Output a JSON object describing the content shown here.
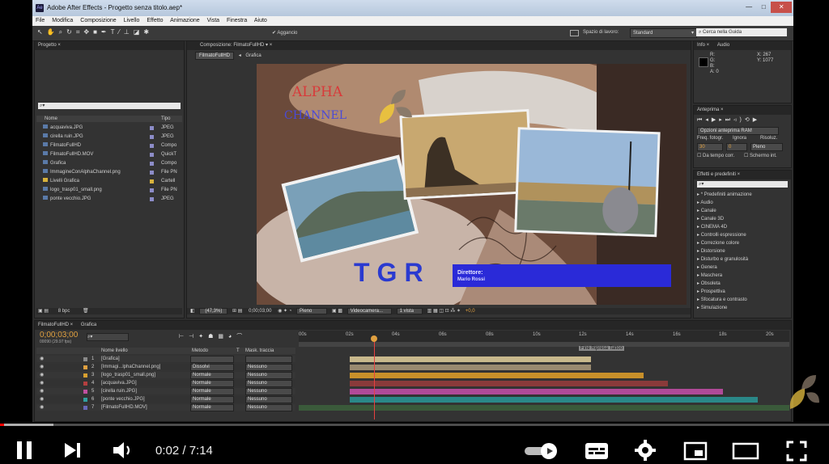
{
  "app": {
    "title": "Adobe After Effects - Progetto senza titolo.aep*",
    "logo_text": "Ae",
    "window_buttons": [
      "—",
      "□",
      "✕"
    ]
  },
  "menu": [
    "File",
    "Modifica",
    "Composizione",
    "Livello",
    "Effetto",
    "Animazione",
    "Vista",
    "Finestra",
    "Aiuto"
  ],
  "toolbar": {
    "snap_label": "Aggancio",
    "workspace_label": "Spazio di lavoro:",
    "workspace_value": "Standard",
    "help_placeholder": "Cerca nella Guida"
  },
  "project_panel": {
    "tab": "Progetto",
    "col_name": "Nome",
    "col_type": "Tipo",
    "items": [
      {
        "name": "acquaviva.JPG",
        "type": "JPEG",
        "color": "#8c8cc8"
      },
      {
        "name": "cirella ruin.JPG",
        "type": "JPEG",
        "color": "#8c8cc8"
      },
      {
        "name": "FilmatoFullHD",
        "type": "Compo",
        "color": "#8c8cc8"
      },
      {
        "name": "FilmatoFullHD.MOV",
        "type": "QuickT",
        "color": "#8c8cc8"
      },
      {
        "name": "Grafica",
        "type": "Compo",
        "color": "#8c8cc8"
      },
      {
        "name": "ImmagineConAlphaChannel.png",
        "type": "File PN",
        "color": "#8c8cc8"
      },
      {
        "name": "Livelli Grafica",
        "type": "Cartell",
        "color": "#d8b23c"
      },
      {
        "name": "logo_trasp01_small.png",
        "type": "File PN",
        "color": "#8c8cc8"
      },
      {
        "name": "ponte vecchio.JPG",
        "type": "JPEG",
        "color": "#8c8cc8"
      }
    ],
    "bpc": "8 bpc"
  },
  "comp_panel": {
    "tab": "Composizione: FilmatoFullHD",
    "subtabs": [
      "FilmatoFullHD",
      "Grafica"
    ],
    "zoom": "(47,3%)",
    "timecode": "0;00;03;00",
    "resolution": "Pieno",
    "camera": "Videocamera...",
    "view": "1 vista",
    "offset": "+0,0"
  },
  "overlay": {
    "alpha_line1": "ALPHA",
    "alpha_line2": "CHANNEL",
    "tgr": "TGR",
    "lower_third_title": "Direttore:",
    "lower_third_name": "Mario Rossi"
  },
  "info_panel": {
    "tabs": [
      "Info",
      "Audio"
    ],
    "channels": [
      "R:",
      "G:",
      "B:",
      "A: 0"
    ],
    "x": "X: 267",
    "y": "Y: 1077"
  },
  "preview_panel": {
    "tab": "Anteprima",
    "ram_options": "Opzioni anteprima RAM",
    "frame_rate_label": "Freq. fotogr.",
    "skip_label": "Ignora",
    "resolution_label": "Risoluz.",
    "frame_rate": "30",
    "skip": "0",
    "resolution": "Pieno",
    "current_time": "Da tempo corr.",
    "fullscreen": "Schermo int."
  },
  "effects_panel": {
    "tab": "Effetti e predefiniti",
    "items": [
      "* Predefiniti animazione",
      "Audio",
      "Canale",
      "Canale 3D",
      "CINEMA 4D",
      "Controlli espressione",
      "Correzione colore",
      "Distorsione",
      "Disturbo e granulosità",
      "Genera",
      "Maschera",
      "Obsoleta",
      "Prospettiva",
      "Sfocatura e contrasto",
      "Simulazione"
    ]
  },
  "timeline": {
    "tabs": [
      "FilmatoFullHD",
      "Grafica"
    ],
    "timecode": "0;00;03;00",
    "timecode_sub": "00090 (29.97 fps)",
    "col_name": "Nome livello",
    "col_mode": "Metodo",
    "col_track": "T",
    "col_matte": "Mask. traccia",
    "ruler": [
      "00s",
      "02s",
      "04s",
      "06s",
      "08s",
      "10s",
      "12s",
      "14s",
      "16s",
      "18s",
      "20s"
    ],
    "marker_label": "Fine Ripresa Tattoo",
    "layers": [
      {
        "num": "1",
        "name": "[Grafica]",
        "mode": "",
        "matte": "",
        "color": "#8a8a8a",
        "bar_color": "#c8b88c",
        "bar_start": 0.104,
        "bar_end": 0.596
      },
      {
        "num": "2",
        "name": "[Immagi...lphaChannel.png]",
        "mode": "Dissolvi",
        "matte": "Nessuno",
        "color": "#e0a040",
        "bar_color": "#9a8a70",
        "bar_start": 0.104,
        "bar_end": 0.596
      },
      {
        "num": "3",
        "name": "[logo_trasp01_small.png]",
        "mode": "Normale",
        "matte": "Nessuno",
        "color": "#d8a030",
        "bar_color": "#c8902a",
        "bar_start": 0.104,
        "bar_end": 0.703
      },
      {
        "num": "4",
        "name": "[acquaviva.JPG]",
        "mode": "Normale",
        "matte": "Nessuno",
        "color": "#b44040",
        "bar_color": "#8a3a3a",
        "bar_start": 0.104,
        "bar_end": 0.753
      },
      {
        "num": "5",
        "name": "[cirella ruin.JPG]",
        "mode": "Normale",
        "matte": "Nessuno",
        "color": "#c050a0",
        "bar_color": "#b04a98",
        "bar_start": 0.104,
        "bar_end": 0.865
      },
      {
        "num": "6",
        "name": "[ponte vecchio.JPG]",
        "mode": "Normale",
        "matte": "Nessuno",
        "color": "#30a0a0",
        "bar_color": "#2a8888",
        "bar_start": 0.104,
        "bar_end": 0.935
      },
      {
        "num": "7",
        "name": "[FilmatoFullHD.MOV]",
        "mode": "Normale",
        "matte": "Nessuno",
        "color": "#6868b8",
        "bar_color": "#3a5a3a",
        "bar_start": 0.0,
        "bar_end": 1.0
      }
    ]
  },
  "player": {
    "time": "0:02 / 7:14",
    "progress": 0.0046,
    "icons": [
      "pause-icon",
      "next-icon",
      "volume-icon",
      "autoplay-toggle",
      "subtitles-icon",
      "settings-icon",
      "miniplayer-icon",
      "theater-icon",
      "fullscreen-icon"
    ]
  }
}
